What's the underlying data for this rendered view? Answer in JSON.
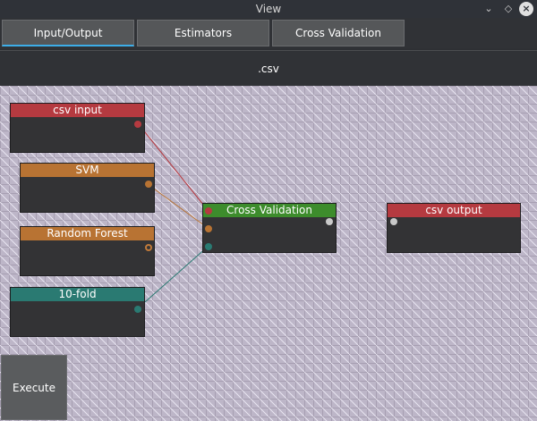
{
  "window": {
    "title": "View"
  },
  "colors": {
    "io_red": "#b53a40",
    "estimator_orange": "#b87333",
    "cv_green": "#3d8c2c",
    "fold_teal": "#2a7a72",
    "output_port_white": "#c9c9c9"
  },
  "tabs": [
    {
      "label": "Input/Output",
      "active": true
    },
    {
      "label": "Estimators",
      "active": false
    },
    {
      "label": "Cross Validation",
      "active": false
    }
  ],
  "file_bar": {
    "text": ".csv"
  },
  "nodes": {
    "csv_input": {
      "title": "csv input"
    },
    "svm": {
      "title": "SVM"
    },
    "random_forest": {
      "title": "Random Forest"
    },
    "ten_fold": {
      "title": "10-fold"
    },
    "cross_validation": {
      "title": "Cross Validation"
    },
    "csv_output": {
      "title": "csv output"
    }
  },
  "actions": {
    "execute_label": "Execute"
  },
  "icons": {
    "minimize": "chevron-down-icon",
    "maximize": "restore-icon",
    "close": "close-icon"
  }
}
